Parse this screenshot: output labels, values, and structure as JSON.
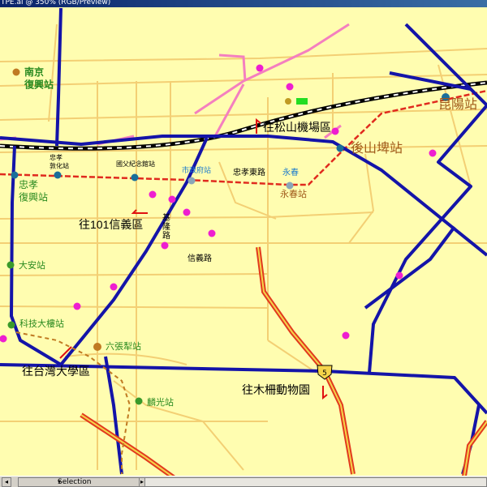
{
  "window": {
    "title": "TPE.ai @ 350% (RGB/Preview)"
  },
  "colors": {
    "map_bg": "#fffdb0",
    "minor_road": "#f3cf74",
    "metro_line": "#1414a8",
    "railway_dashed": "#e02a1e",
    "highway_outer": "#e23a1e",
    "highway_inner": "#f5d44a",
    "pink_road": "#f47fbf",
    "poi_magenta": "#ee1ed0",
    "station_blue": "#1a6f9a",
    "station_green": "#3a9a2a",
    "station_brown": "#c07a22",
    "label_green": "#2a8a20",
    "label_brown": "#a05a1a",
    "label_blue": "#1a7acc",
    "label_black": "#000000",
    "arrow_red": "#e01010"
  },
  "map": {
    "labels": {
      "nanjing_fuxing": "南京\n復興站",
      "kunyang": "昆陽站",
      "songshan_airport": "往松山機場區",
      "houshanpi": "後山埤站",
      "zhongxiao_dunhua": "忠孝\n敦化站",
      "sun_yatsen_memorial": "國父紀念館站",
      "taipei_city_hall": "市政府站",
      "zhongxiao_east_rd": "忠孝東路",
      "yongchun_blue": "永春",
      "yongchun": "永春站",
      "zhongxiao_fuxing": "忠孝\n復興站",
      "to_taipei101": "往101信義區",
      "keelung_rd": "基隆路",
      "xinyi_rd": "信義路",
      "daan": "大安站",
      "technology_bldg": "科技大樓站",
      "liuzhangli": "六張犁站",
      "to_ntu": "往台灣大學區",
      "linguang": "麟光站",
      "to_zoo": "往木柵動物園",
      "highway_shield": "5"
    }
  },
  "statusbar": {
    "mode": "Selection",
    "scroll_left": "◂",
    "scroll_right": "▸"
  }
}
